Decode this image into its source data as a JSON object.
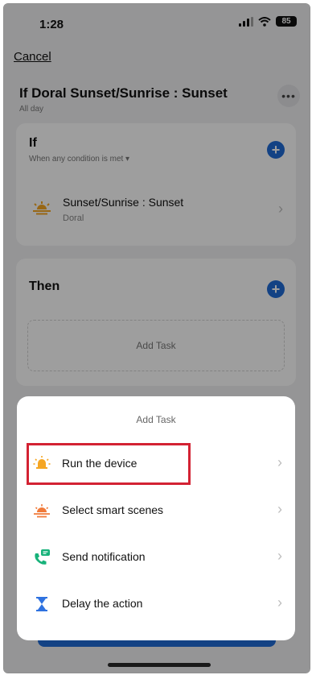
{
  "status_bar": {
    "time": "1:28",
    "battery": "85"
  },
  "nav": {
    "cancel_label": "Cancel",
    "more_label": "•••"
  },
  "header": {
    "title": "If Doral Sunset/Sunrise : Sunset",
    "subtitle": "All day"
  },
  "if_card": {
    "title": "If",
    "condition_mode": "When any condition is met ▾",
    "condition": {
      "title": "Sunset/Sunrise : Sunset",
      "subtitle": "Doral"
    }
  },
  "then_card": {
    "title": "Then",
    "add_task_label": "Add Task"
  },
  "sheet": {
    "title": "Add Task",
    "items": [
      {
        "label": "Run the device",
        "icon": "bulb-icon"
      },
      {
        "label": "Select smart scenes",
        "icon": "sunset-scene-icon"
      },
      {
        "label": "Send notification",
        "icon": "phone-message-icon"
      },
      {
        "label": "Delay the action",
        "icon": "hourglass-icon"
      }
    ]
  },
  "colors": {
    "accent_blue": "#1f6bd6",
    "highlight_red": "#d32233",
    "sun_orange": "#f5a623"
  }
}
